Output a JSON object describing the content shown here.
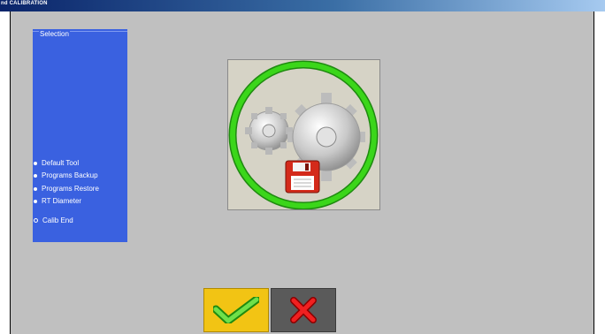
{
  "window": {
    "title": "End CALIBRATION",
    "title_visible": "nd CALIBRATION"
  },
  "selection": {
    "title": "Selection",
    "options": [
      {
        "label": "Default Tool",
        "marker": "bullet"
      },
      {
        "label": "Programs Backup",
        "marker": "bullet"
      },
      {
        "label": "Programs Restore",
        "marker": "bullet"
      },
      {
        "label": "RT Diameter",
        "marker": "bullet"
      },
      {
        "label": "Calib End",
        "marker": "radio-selected"
      }
    ]
  },
  "illustration": {
    "icon": "gears-save-icon",
    "ring_color": "#3bd61a"
  },
  "buttons": {
    "ok_icon": "checkmark-icon",
    "cancel_icon": "cross-icon"
  },
  "colors": {
    "panel": "#3a61e0",
    "ok_button": "#f2c414",
    "cancel_button": "#5a5a5a",
    "background": "#c0c0c0"
  }
}
